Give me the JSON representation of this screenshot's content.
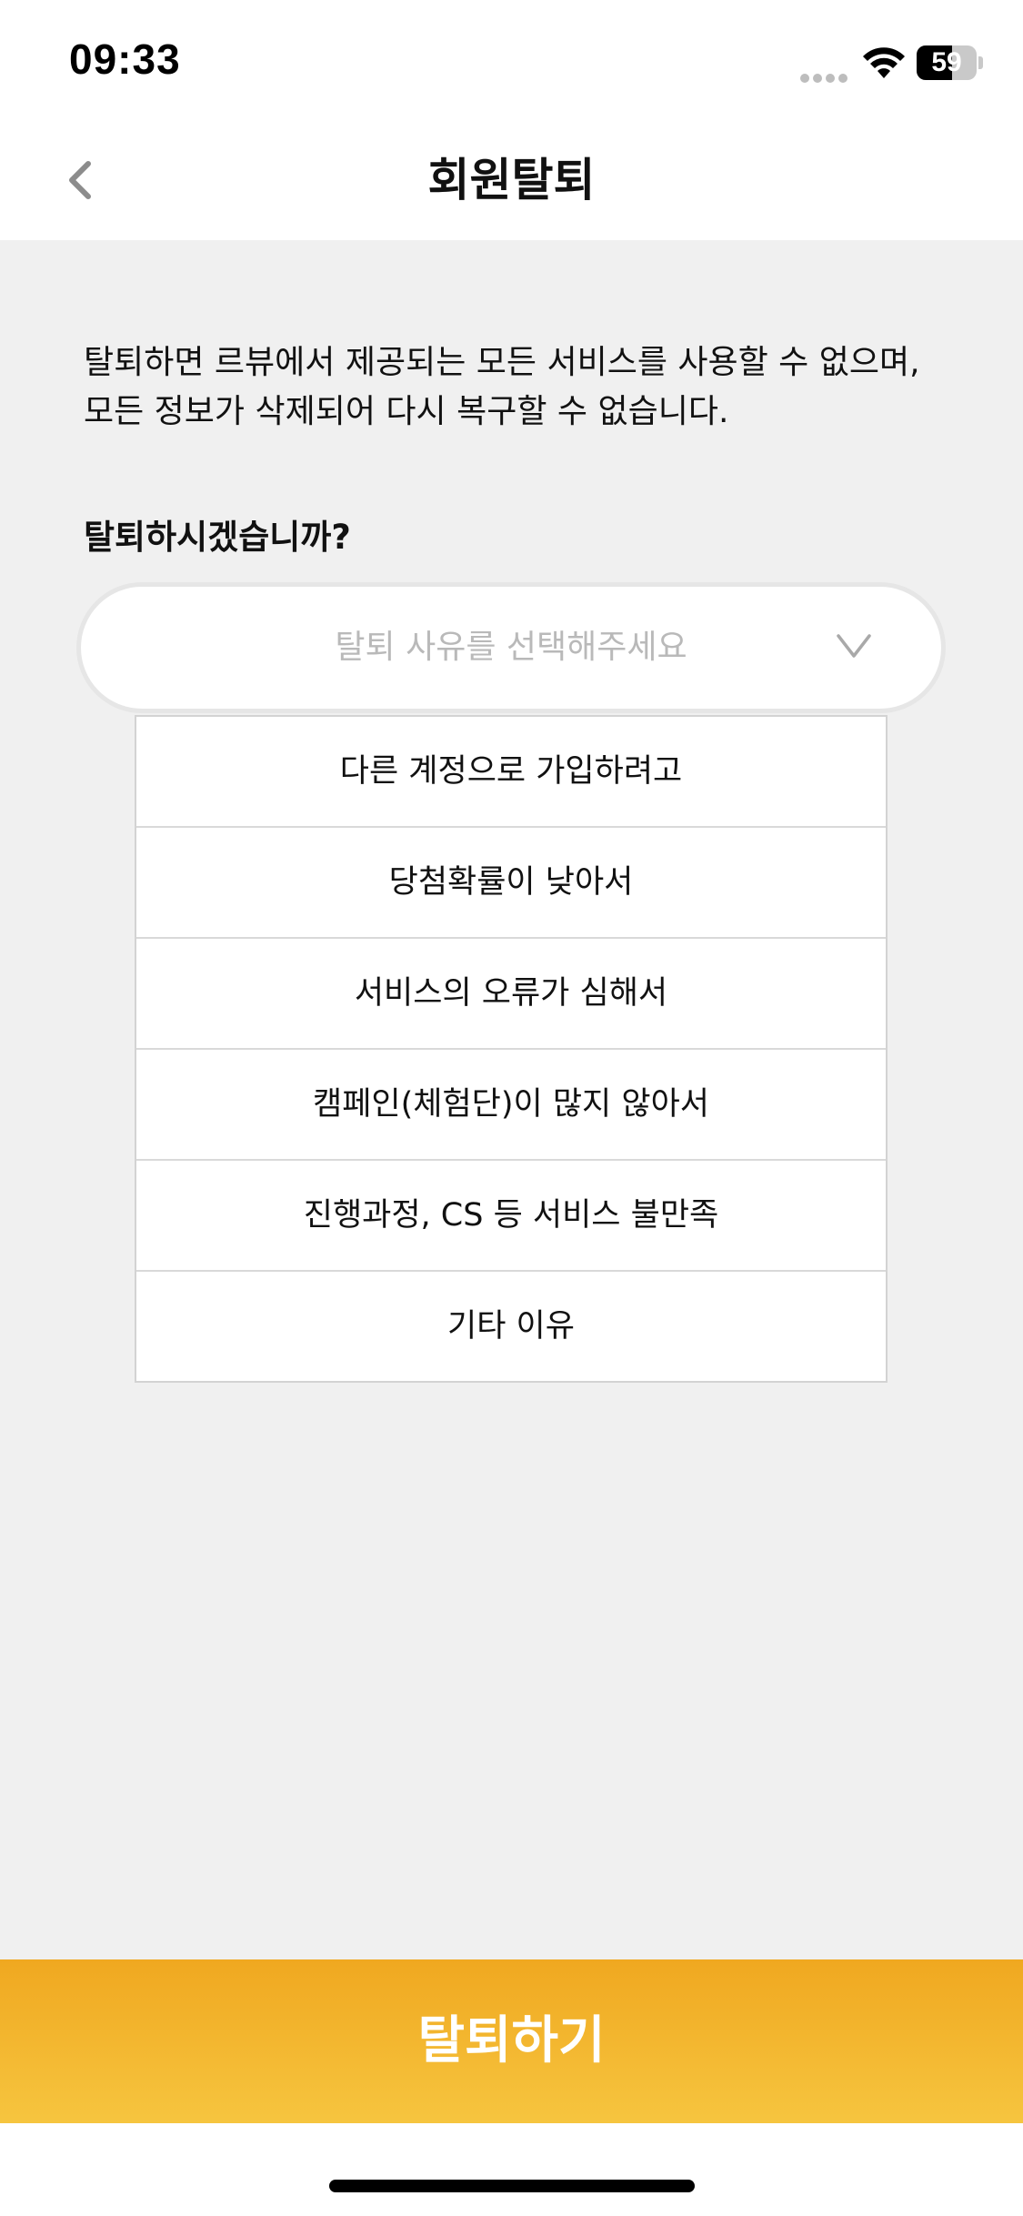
{
  "status_bar": {
    "time": "09:33",
    "battery_level": "59",
    "battery_fraction": 0.59
  },
  "header": {
    "title": "회원탈퇴",
    "back_icon": "chevron-left-icon"
  },
  "notice": {
    "line1": "탈퇴하면 르뷰에서 제공되는 모든 서비스를 사용할 수 없으며,",
    "line2": "모든 정보가 삭제되어 다시 복구할 수 없습니다."
  },
  "question": "탈퇴하시겠습니까?",
  "reason_select": {
    "placeholder": "탈퇴 사유를 선택해주세요",
    "icon": "chevron-down-icon",
    "options": [
      "다른 계정으로 가입하려고",
      "당첨확률이 낮아서",
      "서비스의 오류가 심해서",
      "캠페인(체험단)이 많지 않아서",
      "진행과정, CS 등 서비스 불만족",
      "기타 이유"
    ]
  },
  "withdraw_button": {
    "label": "탈퇴하기"
  },
  "colors": {
    "accent_top": "#f0a820",
    "accent_bottom": "#f6c53f",
    "background": "#f0f0f0"
  }
}
